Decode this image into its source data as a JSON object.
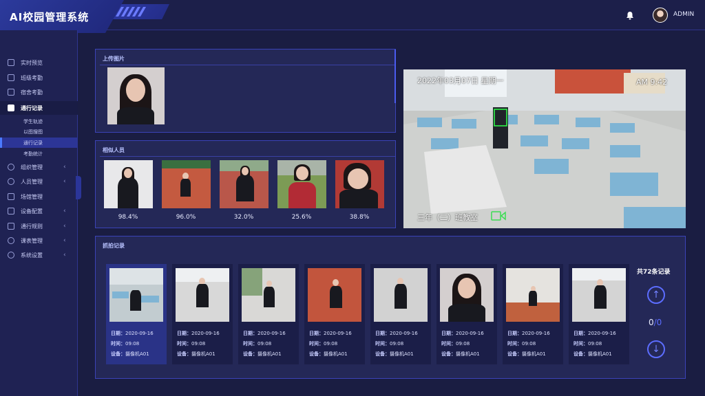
{
  "app": {
    "title": "AI校园管理系统",
    "user": "ADMIN"
  },
  "sidebar": {
    "items": [
      {
        "label": "实时预览",
        "icon": "monitor-icon"
      },
      {
        "label": "班级考勤",
        "icon": "attendance-icon"
      },
      {
        "label": "宿舍考勤",
        "icon": "building-icon"
      },
      {
        "label": "通行记录",
        "icon": "checkbox-icon",
        "active": true
      },
      {
        "label": "组织管理",
        "icon": "org-icon"
      },
      {
        "label": "人员管理",
        "icon": "user-icon"
      },
      {
        "label": "场馆管理",
        "icon": "venue-icon"
      },
      {
        "label": "设备配置",
        "icon": "device-icon"
      },
      {
        "label": "通行规则",
        "icon": "rule-icon"
      },
      {
        "label": "课表管理",
        "icon": "schedule-icon"
      },
      {
        "label": "系统设置",
        "icon": "gear-icon"
      }
    ],
    "sub_items": [
      {
        "label": "学生轨迹"
      },
      {
        "label": "以图搜图"
      },
      {
        "label": "通行记录",
        "active": true
      },
      {
        "label": "考勤统计"
      }
    ]
  },
  "upload": {
    "title": "上传图片"
  },
  "similar": {
    "title": "相似人员",
    "people": [
      {
        "score": "98.4%",
        "scene": "white-wall"
      },
      {
        "score": "96.0%",
        "scene": "running-track"
      },
      {
        "score": "32.0%",
        "scene": "running-track"
      },
      {
        "score": "25.6%",
        "scene": "grass-field"
      },
      {
        "score": "38.8%",
        "scene": "red-wall"
      }
    ]
  },
  "camera": {
    "timestamp_left": "2022年03月07日 星期一",
    "timestamp_right": "AM 9:42",
    "location": "三年（二）班教室"
  },
  "captures": {
    "title": "抓拍记录",
    "date_label": "日期：",
    "time_label": "时间：",
    "device_label": "设备：",
    "total_text": "共72条记录",
    "page_current": "0",
    "page_total": "/0",
    "items": [
      {
        "date": "2020-09-16",
        "time": "09:08",
        "device": "摄像机A01",
        "scene": "classroom"
      },
      {
        "date": "2020-09-16",
        "time": "09:08",
        "device": "摄像机A01",
        "scene": "white-floor"
      },
      {
        "date": "2020-09-16",
        "time": "09:08",
        "device": "摄像机A01",
        "scene": "path"
      },
      {
        "date": "2020-09-16",
        "time": "09:08",
        "device": "摄像机A01",
        "scene": "running-track"
      },
      {
        "date": "2020-09-16",
        "time": "09:08",
        "device": "摄像机A01",
        "scene": "white-floor"
      },
      {
        "date": "2020-09-16",
        "time": "09:08",
        "device": "摄像机A01",
        "scene": "portrait"
      },
      {
        "date": "2020-09-16",
        "time": "09:08",
        "device": "摄像机A01",
        "scene": "corridor"
      },
      {
        "date": "2020-09-16",
        "time": "09:08",
        "device": "摄像机A01",
        "scene": "white-floor"
      }
    ]
  }
}
